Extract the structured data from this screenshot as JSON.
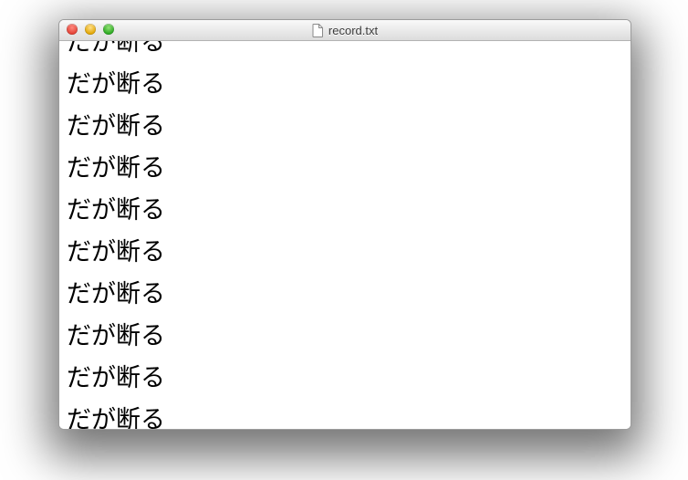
{
  "window": {
    "title": "record.txt"
  },
  "content": {
    "lines": [
      "だが断る",
      "だが断る",
      "だが断る",
      "だが断る",
      "だが断る",
      "だが断る",
      "だが断る",
      "だが断る",
      "だが断る",
      "だが断る"
    ]
  }
}
